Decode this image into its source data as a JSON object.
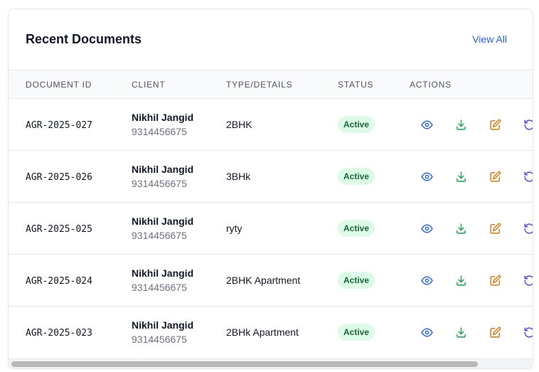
{
  "card": {
    "title": "Recent Documents",
    "view_all": "View All"
  },
  "table": {
    "headers": [
      "DOCUMENT ID",
      "CLIENT",
      "TYPE/DETAILS",
      "STATUS",
      "ACTIONS"
    ],
    "rows": [
      {
        "id": "AGR-2025-027",
        "client_name": "Nikhil Jangid",
        "client_phone": "9314456675",
        "type": "2BHK",
        "status": "Active"
      },
      {
        "id": "AGR-2025-026",
        "client_name": "Nikhil Jangid",
        "client_phone": "9314456675",
        "type": "3BHk",
        "status": "Active"
      },
      {
        "id": "AGR-2025-025",
        "client_name": "Nikhil Jangid",
        "client_phone": "9314456675",
        "type": "ryty",
        "status": "Active"
      },
      {
        "id": "AGR-2025-024",
        "client_name": "Nikhil Jangid",
        "client_phone": "9314456675",
        "type": "2BHK Apartment",
        "status": "Active"
      },
      {
        "id": "AGR-2025-023",
        "client_name": "Nikhil Jangid",
        "client_phone": "9314456675",
        "type": "2BHk Apartment",
        "status": "Active"
      }
    ],
    "actions": [
      "eye-icon",
      "download-icon",
      "edit-icon",
      "rotate-icon"
    ]
  },
  "colors": {
    "view": "#2563eb",
    "download": "#16a34a",
    "edit": "#d97706",
    "rotate": "#4f46e5",
    "badge_bg": "#dcfce7",
    "badge_text": "#166534"
  }
}
